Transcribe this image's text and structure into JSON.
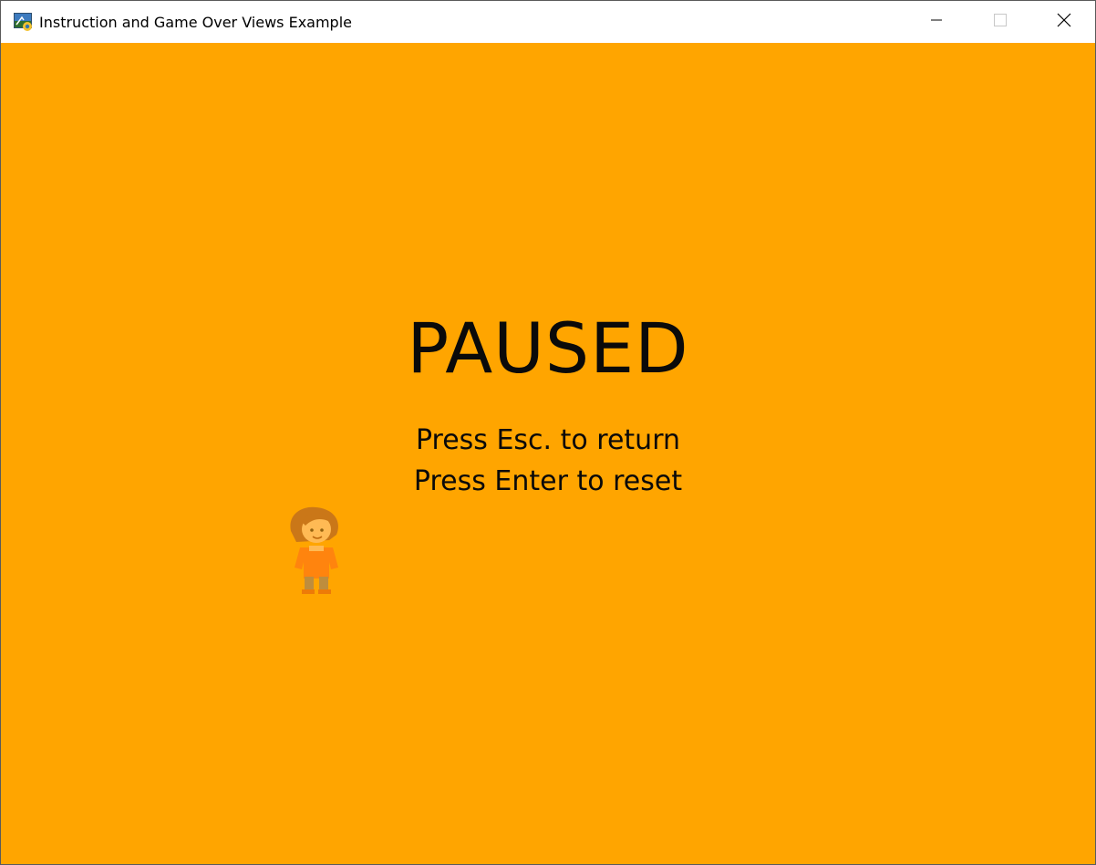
{
  "window": {
    "title": "Instruction and Game Over Views Example",
    "icon": "python-app-icon",
    "controls": {
      "minimize": "minimize-icon",
      "maximize": "maximize-icon",
      "close": "close-icon"
    }
  },
  "game": {
    "background_color": "#ffa500",
    "heading": "PAUSED",
    "instructions": [
      "Press Esc. to return",
      "Press Enter to reset"
    ],
    "sprite": "player-character-sprite"
  }
}
